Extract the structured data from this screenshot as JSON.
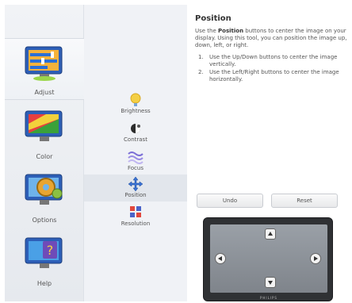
{
  "categories": [
    {
      "label": "Adjust",
      "icon": "monitor-adjust-icon",
      "active": true
    },
    {
      "label": "Color",
      "icon": "color-icon",
      "active": false
    },
    {
      "label": "Options",
      "icon": "options-gear-icon",
      "active": false
    },
    {
      "label": "Help",
      "icon": "help-icon",
      "active": false
    }
  ],
  "sub_items": [
    {
      "label": "Brightness",
      "icon": "brightness-icon"
    },
    {
      "label": "Contrast",
      "icon": "contrast-icon"
    },
    {
      "label": "Focus",
      "icon": "focus-icon"
    },
    {
      "label": "Position",
      "icon": "position-icon",
      "active": true
    },
    {
      "label": "Resolution",
      "icon": "resolution-icon"
    }
  ],
  "panel": {
    "title": "Position",
    "desc_prefix": "Use the ",
    "desc_bold": "Position",
    "desc_suffix": " buttons to center the image on your display. Using this tool, you can position the image up, down, left, or right.",
    "steps": [
      {
        "num": "1.",
        "text": "Use the Up/Down buttons to center the image vertically."
      },
      {
        "num": "2.",
        "text": "Use the Left/Right buttons to center the image horizontally."
      }
    ],
    "undo_label": "Undo",
    "reset_label": "Reset",
    "monitor_brand": "PHILIPS"
  }
}
